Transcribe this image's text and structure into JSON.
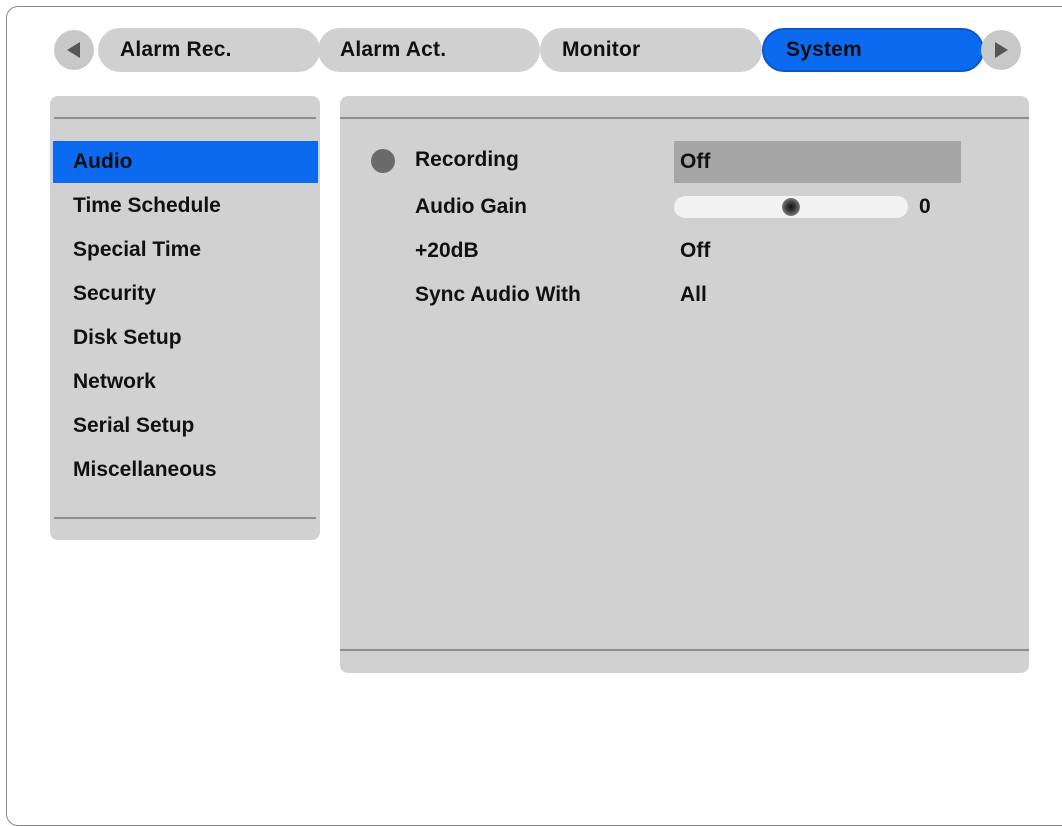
{
  "tabs": [
    {
      "label": "Alarm Rec."
    },
    {
      "label": "Alarm Act."
    },
    {
      "label": "Monitor"
    },
    {
      "label": "System",
      "selected": true
    }
  ],
  "nav_arrows": {
    "left": "triangle-left-icon",
    "right": "triangle-right-icon"
  },
  "sidebar": {
    "items": [
      {
        "label": "Audio",
        "selected": true
      },
      {
        "label": "Time Schedule"
      },
      {
        "label": "Special Time"
      },
      {
        "label": "Security"
      },
      {
        "label": "Disk Setup"
      },
      {
        "label": "Network"
      },
      {
        "label": "Serial Setup"
      },
      {
        "label": "Miscellaneous"
      }
    ]
  },
  "settings": {
    "recording": {
      "label": "Recording",
      "value": "Off"
    },
    "audio_gain": {
      "label": "Audio Gain",
      "value": "0",
      "level_fraction": 0.5
    },
    "boost": {
      "label": "+20dB",
      "value": "Off"
    },
    "sync_audio": {
      "label": "Sync Audio With",
      "value": "All"
    }
  },
  "colors": {
    "accent": "#0b6af0",
    "panel": "#d1d1d1",
    "tab": "#d0d0d0",
    "selected_field": "#a6a6a6",
    "rule": "#8e8e8e"
  }
}
